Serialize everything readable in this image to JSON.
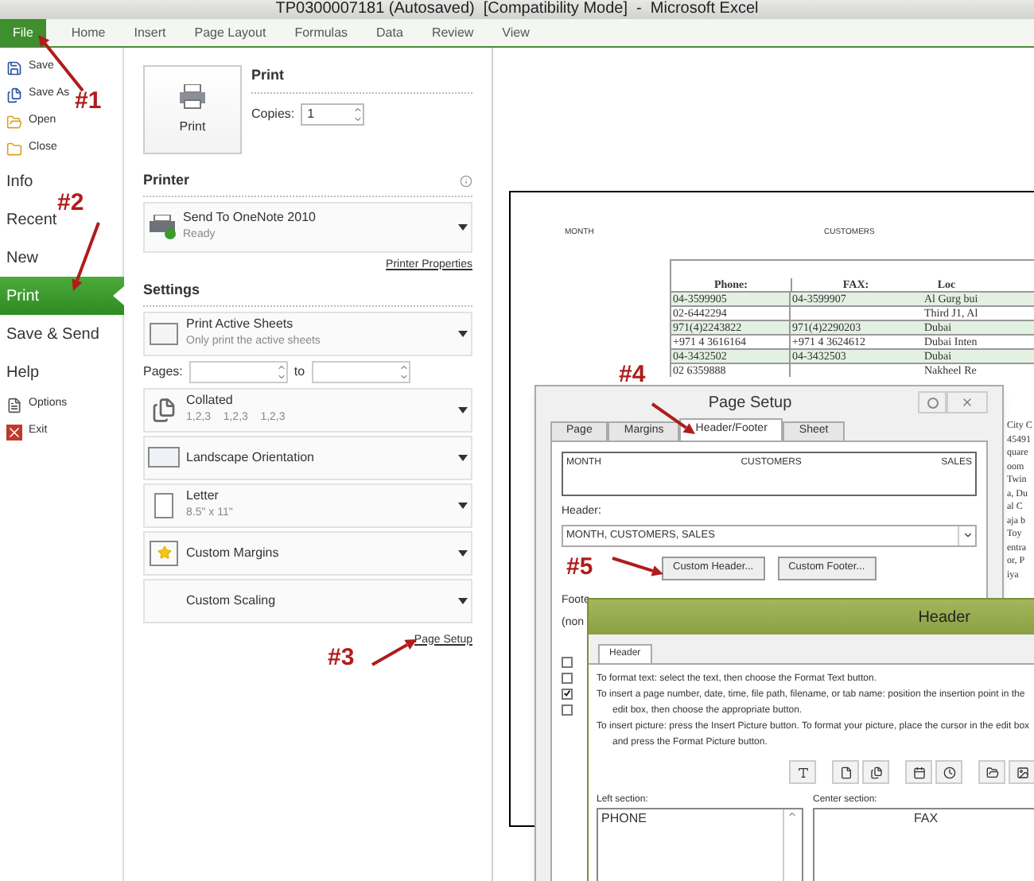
{
  "window": {
    "title": "TP0300007181 (Autosaved)  [Compatibility Mode]  -  Microsoft Excel"
  },
  "ribbon_tabs": [
    {
      "label": "File",
      "selected": true
    },
    {
      "label": "Home",
      "selected": false
    },
    {
      "label": "Insert",
      "selected": false
    },
    {
      "label": "Page Layout",
      "selected": false
    },
    {
      "label": "Formulas",
      "selected": false
    },
    {
      "label": "Data",
      "selected": false
    },
    {
      "label": "Review",
      "selected": false
    },
    {
      "label": "View",
      "selected": false
    }
  ],
  "backstage_nav": [
    {
      "label": "Save",
      "kind": "save",
      "selected": false
    },
    {
      "label": "Save As",
      "kind": "saveas",
      "selected": false
    },
    {
      "label": "Open",
      "kind": "open",
      "selected": false
    },
    {
      "label": "Close",
      "kind": "close",
      "selected": false
    },
    {
      "label": "Info",
      "kind": "section",
      "selected": false
    },
    {
      "label": "Recent",
      "kind": "section",
      "selected": false
    },
    {
      "label": "New",
      "kind": "section",
      "selected": false
    },
    {
      "label": "Print",
      "kind": "section",
      "selected": true
    },
    {
      "label": "Save & Send",
      "kind": "section",
      "selected": false
    },
    {
      "label": "Help",
      "kind": "section",
      "selected": false
    },
    {
      "label": "Options",
      "kind": "options",
      "selected": false
    },
    {
      "label": "Exit",
      "kind": "exit",
      "selected": false
    }
  ],
  "print": {
    "heading": "Print",
    "button": "Print",
    "copies_label": "Copies:",
    "copies": "1"
  },
  "printer": {
    "heading": "Printer",
    "name": "Send To OneNote 2010",
    "status": "Ready",
    "properties_link": "Printer Properties"
  },
  "settings": {
    "heading": "Settings",
    "options": [
      {
        "kind": "sheets",
        "title": "Print Active Sheets",
        "subtitle": "Only print the active sheets"
      },
      {
        "kind": "pages",
        "title": "Pages:",
        "subtitle": "to"
      },
      {
        "kind": "collated",
        "title": "Collated",
        "subtitle": "1,2,3    1,2,3    1,2,3"
      },
      {
        "kind": "orientation",
        "title": "Landscape Orientation"
      },
      {
        "kind": "paper",
        "title": "Letter",
        "subtitle": "8.5\" x 11\""
      },
      {
        "kind": "margins",
        "title": "Custom Margins"
      },
      {
        "kind": "scaling",
        "title": "Custom Scaling"
      }
    ],
    "page_setup_link": "Page Setup"
  },
  "preview": {
    "header_left": "MONTH",
    "header_center": "CUSTOMERS",
    "columns": [
      "Phone:",
      "FAX:",
      "Loc"
    ],
    "rows": [
      {
        "cells": [
          "04-3599905",
          "04-3599907",
          "Al Gurg bui"
        ],
        "shaded": true
      },
      {
        "cells": [
          "02-6442294",
          "",
          "Third J1, Al"
        ],
        "shaded": false
      },
      {
        "cells": [
          "971(4)2243822",
          "971(4)2290203",
          "Dubai"
        ],
        "shaded": true
      },
      {
        "cells": [
          "+971 4 3616164",
          "+971 4 3624612",
          "Dubai Inten"
        ],
        "shaded": false
      },
      {
        "cells": [
          "04-3432502",
          "04-3432503",
          "Dubai"
        ],
        "shaded": true
      },
      {
        "cells": [
          "02 6359888",
          "",
          "Nakheel Re"
        ],
        "shaded": false
      }
    ],
    "location_fragments": [
      "City C",
      "45491",
      "quare",
      "oom",
      "Twin",
      "a, Du",
      "al C",
      "aja b",
      "Toy",
      "entra",
      "or, P",
      "iya"
    ]
  },
  "page_setup": {
    "title": "Page Setup",
    "tabs": [
      {
        "label": "Page",
        "selected": false
      },
      {
        "label": "Margins",
        "selected": false
      },
      {
        "label": "Header/Footer",
        "selected": true
      },
      {
        "label": "Sheet",
        "selected": false
      }
    ],
    "preview": [
      "MONTH",
      "CUSTOMERS",
      "SALES"
    ],
    "header_label": "Header:",
    "header_value": "MONTH, CUSTOMERS, SALES",
    "buttons": [
      "Custom Header...",
      "Custom Footer..."
    ],
    "footer_label": "Foote",
    "footer_value": "(non",
    "checkboxes": [
      {
        "checked": false
      },
      {
        "checked": false
      },
      {
        "checked": true
      },
      {
        "checked": false
      }
    ]
  },
  "header_dialog": {
    "title": "Header",
    "tab": "Header",
    "instructions": [
      "To format text:  select the text, then choose the Format Text button.",
      "To insert a page number, date, time, file path, filename, or tab name:  position the insertion point in the edit box, then choose the appropriate button.",
      "To insert picture:  press the Insert Picture button.  To format your picture, place the cursor in the edit box and press the Format Picture button."
    ],
    "left_label": "Left section:",
    "left_value": "PHONE",
    "center_label": "Center section:",
    "center_value": "FAX"
  },
  "annotations": [
    {
      "label": "#1"
    },
    {
      "label": "#2"
    },
    {
      "label": "#3"
    },
    {
      "label": "#4"
    },
    {
      "label": "#5"
    }
  ]
}
